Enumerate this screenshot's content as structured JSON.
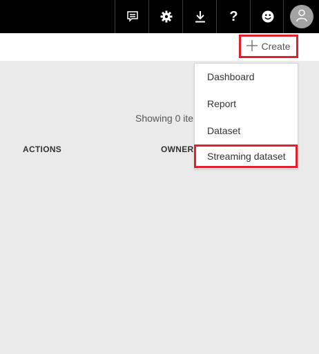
{
  "topbar": {
    "buttons": [
      {
        "icon": "feedback-icon"
      },
      {
        "icon": "gear-icon"
      },
      {
        "icon": "download-icon"
      },
      {
        "icon": "help-icon"
      },
      {
        "icon": "smiley-icon"
      }
    ],
    "avatar_icon": "user-icon"
  },
  "actionbar": {
    "create_label": "Create",
    "highlight_color": "#e0202d"
  },
  "main": {
    "showing_text": "Showing 0 ite",
    "columns": [
      "ACTIONS",
      "OWNER"
    ]
  },
  "create_menu": {
    "items": [
      "Dashboard",
      "Report",
      "Dataset",
      "Streaming dataset"
    ]
  }
}
